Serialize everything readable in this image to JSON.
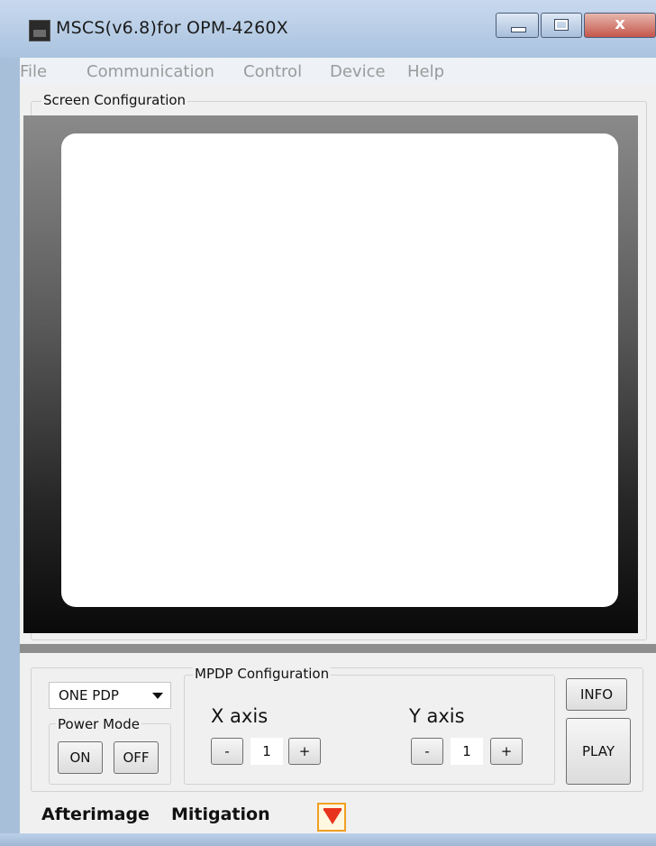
{
  "window": {
    "title": "MSCS(v6.8)for OPM-4260X",
    "controls": {
      "minimize_icon": "minimize-icon",
      "maximize_icon": "maximize-icon",
      "close_glyph": "x"
    }
  },
  "menubar": {
    "items": [
      "File",
      "Communication",
      "Control",
      "Device",
      "Help"
    ]
  },
  "screen_configuration": {
    "label": "Screen Configuration"
  },
  "controls": {
    "display_select": {
      "value": "ONE PDP"
    },
    "power_mode": {
      "label": "Power Mode",
      "on_label": "ON",
      "off_label": "OFF"
    },
    "mpdp": {
      "label": "MPDP Configuration",
      "x_axis": {
        "label": "X axis",
        "minus": "-",
        "value": "1",
        "plus": "+"
      },
      "y_axis": {
        "label": "Y axis",
        "minus": "-",
        "value": "1",
        "plus": "+"
      }
    },
    "info_label": "INFO",
    "play_label": "PLAY"
  },
  "afterimage": {
    "label_1": "Afterimage",
    "label_2": "Mitigation"
  },
  "colors": {
    "accent_orange": "#f0a020",
    "arrow_red": "#e8341c",
    "title_blue": "#aac3df"
  }
}
